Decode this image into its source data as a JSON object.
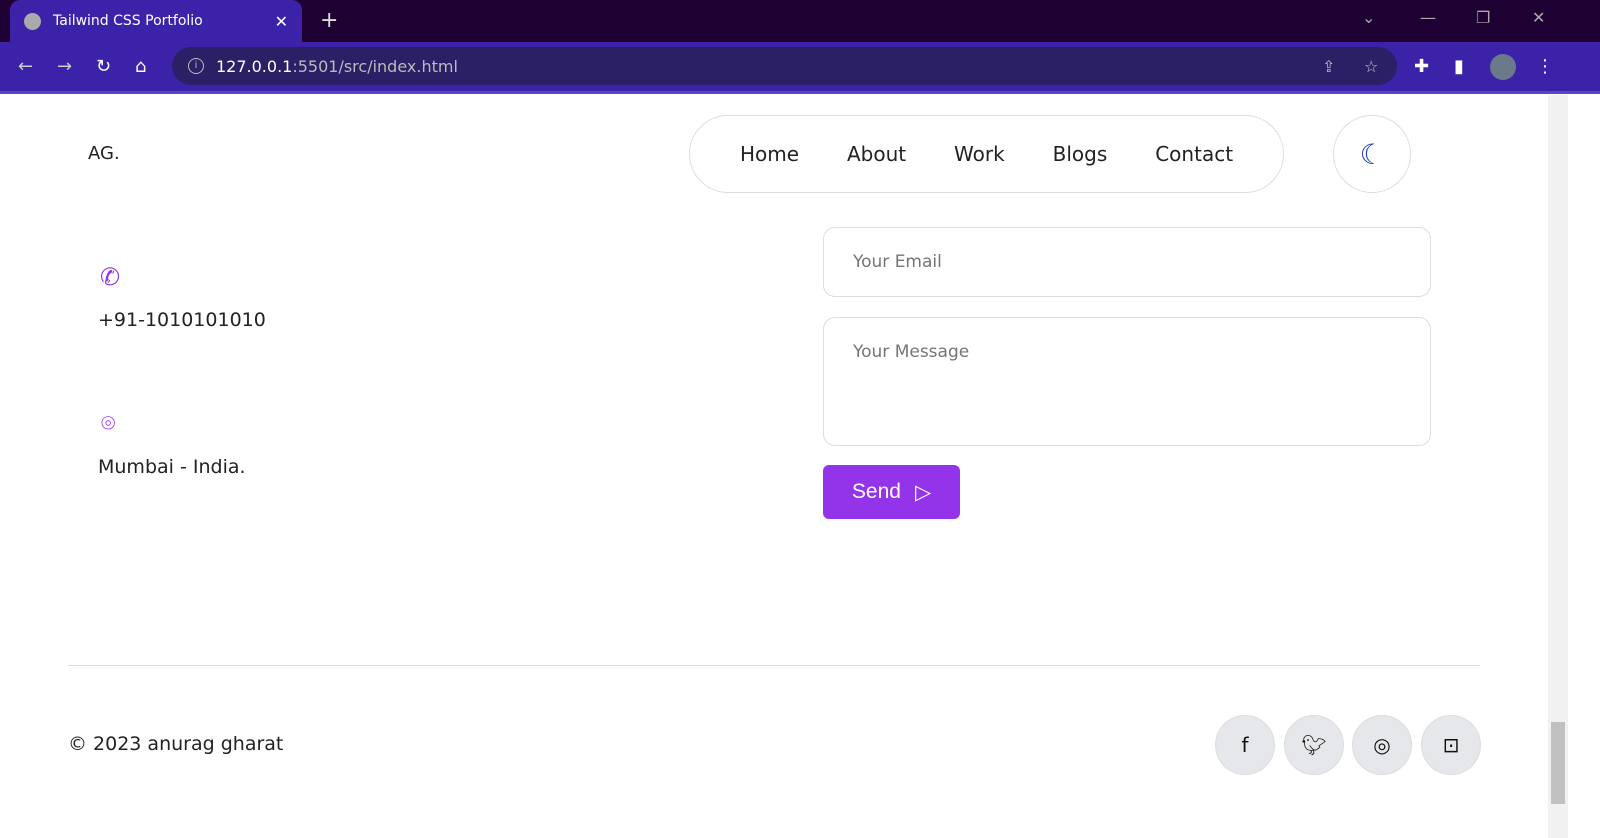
{
  "browser": {
    "tab_title": "Tailwind CSS Portfolio",
    "url_host": "127.0.0.1",
    "url_rest": ":5501/src/index.html"
  },
  "header": {
    "logo": "AG.",
    "nav": [
      "Home",
      "About",
      "Work",
      "Blogs",
      "Contact"
    ]
  },
  "contact": {
    "phone": "+91-1010101010",
    "location": "Mumbai - India."
  },
  "form": {
    "email_placeholder": "Your Email",
    "message_placeholder": "Your Message",
    "send_label": "Send"
  },
  "footer": {
    "copyright": "© 2023 anurag gharat"
  },
  "colors": {
    "accent": "#9333ea",
    "moon": "#1d3fbf"
  }
}
